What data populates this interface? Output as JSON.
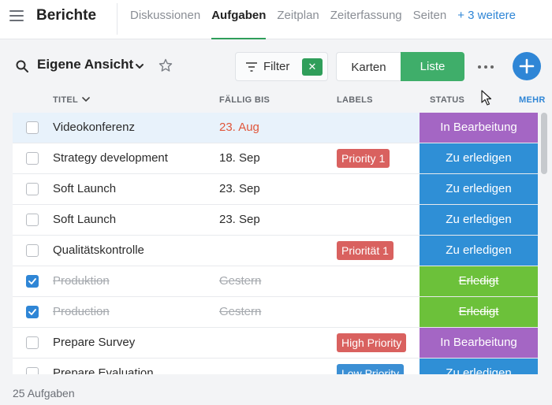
{
  "nav": {
    "title": "Berichte",
    "tabs": [
      {
        "label": "Diskussionen",
        "active": false
      },
      {
        "label": "Aufgaben",
        "active": true
      },
      {
        "label": "Zeitplan",
        "active": false
      },
      {
        "label": "Zeiterfassung",
        "active": false
      },
      {
        "label": "Seiten",
        "active": false
      }
    ],
    "more_label": "+ 3 weitere"
  },
  "toolbar": {
    "view_title": "Eigene Ansicht",
    "filter_label": "Filter",
    "filter_clear": "✕",
    "cards_label": "Karten",
    "list_label": "Liste",
    "icons": [
      "search-icon",
      "chevron-down-icon",
      "star-icon",
      "filter-icon",
      "more-icon",
      "plus-icon"
    ]
  },
  "table": {
    "headers": {
      "title": "TITEL",
      "due": "FÄLLIG BIS",
      "labels": "LABELS",
      "status": "STATUS",
      "more": "MEHR"
    },
    "rows": [
      {
        "title": "Videokonferenz",
        "due": "23. Aug",
        "overdue": true,
        "label": "",
        "status": "In Bearbeitung",
        "done": false,
        "selected": true
      },
      {
        "title": "Strategy development",
        "due": "18. Sep",
        "overdue": false,
        "label": "Priority 1",
        "status": "Zu erledigen",
        "done": false,
        "selected": false
      },
      {
        "title": "Soft Launch",
        "due": "23. Sep",
        "overdue": false,
        "label": "",
        "status": "Zu erledigen",
        "done": false,
        "selected": false
      },
      {
        "title": "Soft Launch",
        "due": "23. Sep",
        "overdue": false,
        "label": "",
        "status": "Zu erledigen",
        "done": false,
        "selected": false
      },
      {
        "title": "Qualitätskontrolle",
        "due": "",
        "overdue": false,
        "label": "Priorität 1",
        "status": "Zu erledigen",
        "done": false,
        "selected": false
      },
      {
        "title": "Produktion",
        "due": "Gestern",
        "overdue": false,
        "label": "",
        "status": "Erledigt",
        "done": true,
        "selected": false
      },
      {
        "title": "Production",
        "due": "Gestern",
        "overdue": false,
        "label": "",
        "status": "Erledigt",
        "done": true,
        "selected": false
      },
      {
        "title": "Prepare Survey",
        "due": "",
        "overdue": false,
        "label": "High Priority",
        "status": "In Bearbeitung",
        "done": false,
        "selected": false
      },
      {
        "title": "Prepare Evaluation",
        "due": "",
        "overdue": false,
        "label": "Low Priority",
        "status": "Zu erledigen",
        "done": false,
        "selected": false
      }
    ]
  },
  "colors": {
    "accent_green": "#3fae6a",
    "accent_blue": "#2f86d6",
    "status_in_progress": "#a466c4",
    "status_todo": "#2f8fd6",
    "status_done": "#6cc13a",
    "label_priority": "#d9615f",
    "label_low": "#3b8fd4",
    "overdue": "#e0563b"
  },
  "footer": {
    "count": "25 Aufgaben"
  }
}
